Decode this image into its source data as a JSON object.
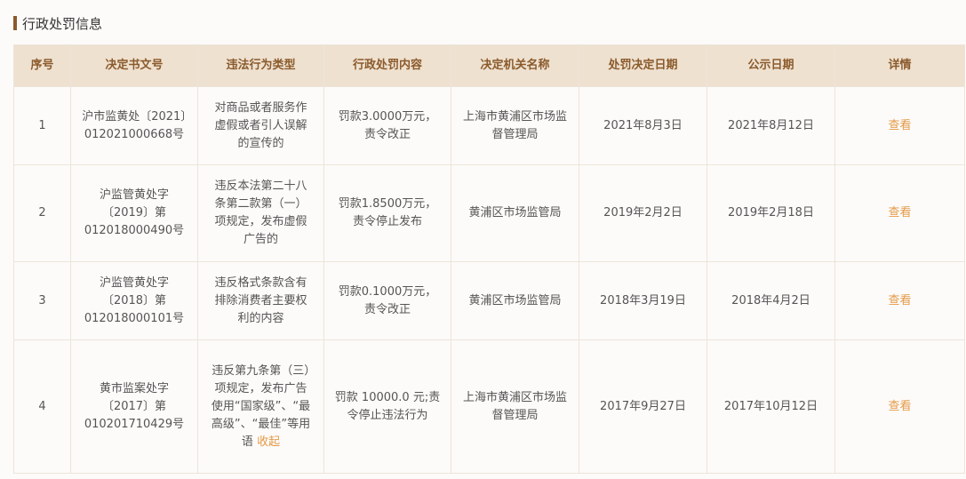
{
  "section": {
    "title": "行政处罚信息"
  },
  "table": {
    "headers": [
      "序号",
      "决定书文号",
      "违法行为类型",
      "行政处罚内容",
      "决定机关名称",
      "处罚决定日期",
      "公示日期",
      "详情"
    ],
    "rows": [
      {
        "index": "1",
        "doc_no": "沪市监黄处〔2021〕012021000668号",
        "violation": "对商品或者服务作虚假或者引人误解的宣传的",
        "penalty": "罚款3.0000万元，责令改正",
        "authority": "上海市黄浦区市场监督管理局",
        "decision_date": "2021年8月3日",
        "publish_date": "2021年8月12日",
        "detail_link": "查看"
      },
      {
        "index": "2",
        "doc_no": "沪监管黄处字〔2019〕第012018000490号",
        "violation": "违反本法第二十八条第二款第（一）项规定，发布虚假广告的",
        "penalty": "罚款1.8500万元，责令停止发布",
        "authority": "黄浦区市场监管局",
        "decision_date": "2019年2月2日",
        "publish_date": "2019年2月18日",
        "detail_link": "查看"
      },
      {
        "index": "3",
        "doc_no": "沪监管黄处字〔2018〕第012018000101号",
        "violation": "违反格式条款含有排除消费者主要权利的内容",
        "penalty": "罚款0.1000万元，责令改正",
        "authority": "黄浦区市场监管局",
        "decision_date": "2018年3月19日",
        "publish_date": "2018年4月2日",
        "detail_link": "查看"
      },
      {
        "index": "4",
        "doc_no": "黄市监案处字〔2017〕第010201710429号",
        "violation": "违反第九条第（三）项规定，发布广告使用“国家级”、“最高级”、“最佳”等用语",
        "violation_toggle": "收起",
        "penalty": "罚款 10000.0 元;责令停止违法行为",
        "authority": "上海市黄浦区市场监督管理局",
        "decision_date": "2017年9月27日",
        "publish_date": "2017年10月12日",
        "detail_link": "查看"
      }
    ]
  }
}
